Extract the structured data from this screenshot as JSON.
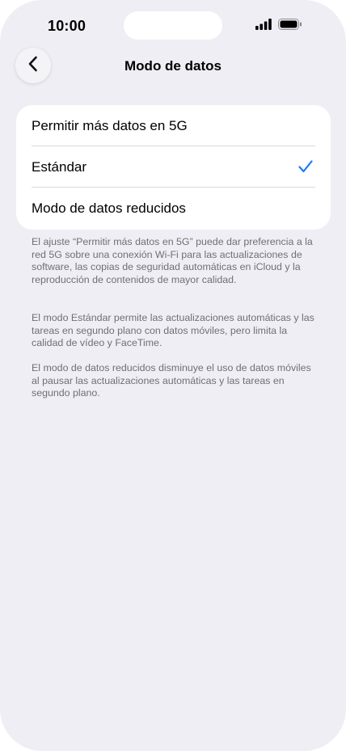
{
  "status_bar": {
    "time": "10:00"
  },
  "nav": {
    "back_icon": "chevron-left-icon",
    "title": "Modo de datos"
  },
  "options": {
    "items": [
      {
        "label": "Permitir más datos en 5G",
        "selected": false
      },
      {
        "label": "Estándar",
        "selected": true
      },
      {
        "label": "Modo de datos reducidos",
        "selected": false
      }
    ],
    "check_icon": "checkmark-icon",
    "accent_color": "#1a7cf5"
  },
  "descriptions": {
    "p1": "El ajuste “Permitir más datos en 5G” puede dar preferencia a la red 5G sobre una conexión Wi‑Fi para las actualizaciones de software, las copias de seguridad automáticas en iCloud y la reproducción de contenidos de mayor calidad.",
    "p2": "El modo Estándar permite las actualizaciones automáticas y las tareas en segundo plano con datos móviles, pero limita la calidad de vídeo y FaceTime.",
    "p3": "El modo de datos reducidos disminuye el uso de datos móviles al pausar las actualizaciones automáticas y las tareas en segundo plano."
  },
  "colors": {
    "background": "#efeef4",
    "card": "#ffffff",
    "secondary_text": "#6f6f74"
  }
}
